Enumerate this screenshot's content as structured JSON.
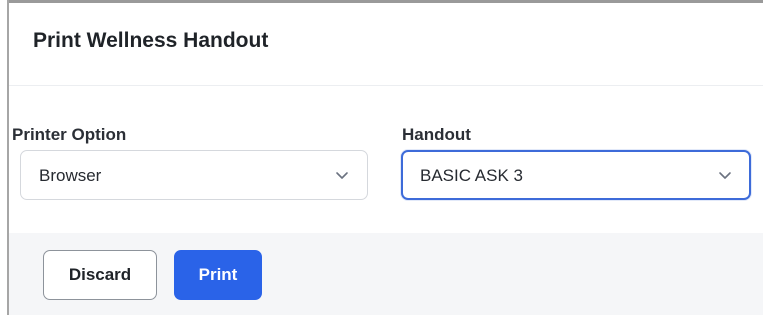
{
  "dialog": {
    "title": "Print Wellness Handout"
  },
  "form": {
    "printer_option": {
      "label": "Printer Option",
      "value": "Browser"
    },
    "handout": {
      "label": "Handout",
      "value": "BASIC ASK 3"
    }
  },
  "footer": {
    "discard_label": "Discard",
    "print_label": "Print"
  },
  "icons": {
    "dropdown": "chevron-down-icon"
  },
  "colors": {
    "primary": "#2a63e8",
    "focus_border": "#3d6bd9",
    "footer_bg": "#f5f6f8"
  }
}
